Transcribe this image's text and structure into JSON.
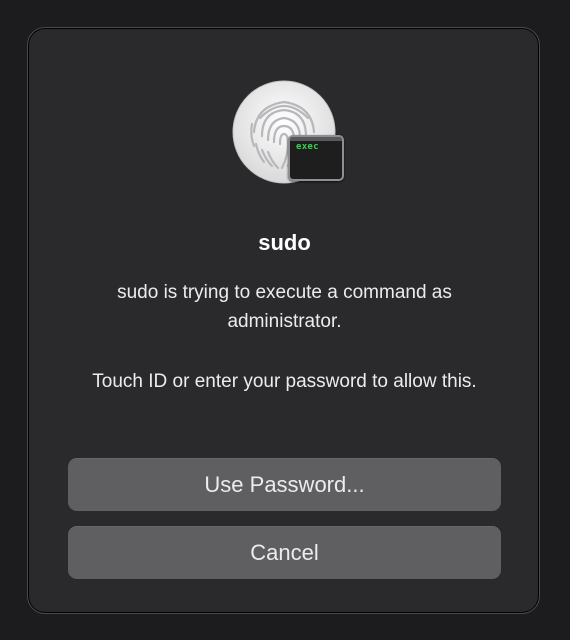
{
  "dialog": {
    "title": "sudo",
    "message": "sudo is trying to execute a command as administrator.",
    "prompt": "Touch ID or enter your password to allow this.",
    "badge_text": "exec",
    "icon": "touch-id-fingerprint-icon",
    "badge_icon": "terminal-icon",
    "buttons": {
      "use_password": "Use Password...",
      "cancel": "Cancel"
    }
  },
  "colors": {
    "background": "#1c1c1e",
    "dialog": "#2a2a2c",
    "button": "#5f5f62",
    "terminal_text": "#37d34d"
  }
}
